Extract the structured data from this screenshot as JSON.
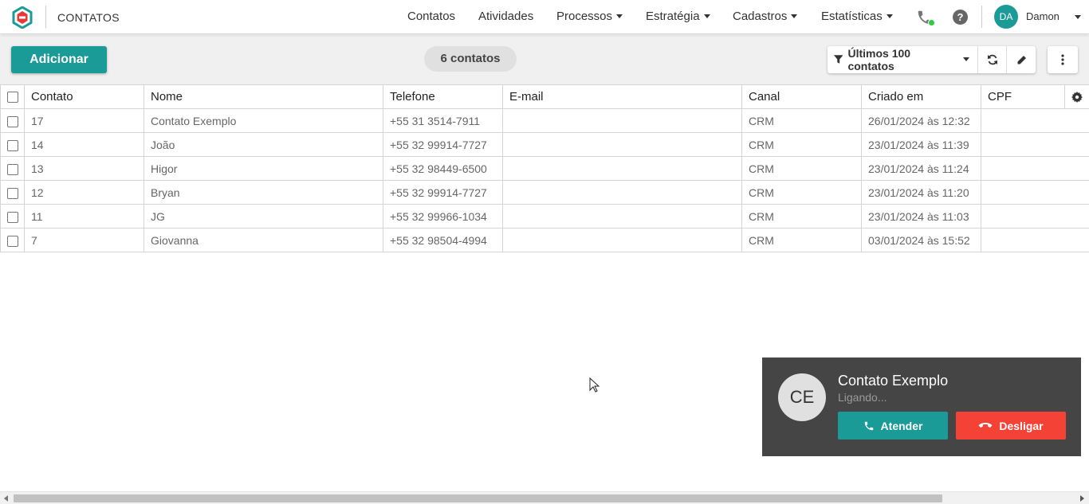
{
  "header": {
    "page_title": "CONTATOS",
    "menu": [
      {
        "label": "Contatos",
        "dropdown": false
      },
      {
        "label": "Atividades",
        "dropdown": false
      },
      {
        "label": "Processos",
        "dropdown": true
      },
      {
        "label": "Estratégia",
        "dropdown": true
      },
      {
        "label": "Cadastros",
        "dropdown": true
      },
      {
        "label": "Estatísticas",
        "dropdown": true
      }
    ],
    "phone_status_color": "#2ecc40",
    "help_label": "?",
    "user": {
      "initials": "DA",
      "name": "Damon"
    }
  },
  "toolbar": {
    "add_label": "Adicionar",
    "count_label": "6 contatos",
    "filter_label": "Últimos 100 contatos",
    "icons": [
      "filter-icon",
      "refresh-icon",
      "pencil-icon",
      "more-vertical-icon"
    ]
  },
  "table": {
    "columns": [
      "Contato",
      "Nome",
      "Telefone",
      "E-mail",
      "Canal",
      "Criado em",
      "CPF"
    ],
    "rows": [
      {
        "contato": "17",
        "nome": "Contato Exemplo",
        "telefone": "+55 31 3514-7911",
        "email": "",
        "canal": "CRM",
        "criado": "26/01/2024 às 12:32",
        "cpf": ""
      },
      {
        "contato": "14",
        "nome": "João",
        "telefone": "+55 32 99914-7727",
        "email": "",
        "canal": "CRM",
        "criado": "23/01/2024 às 11:39",
        "cpf": ""
      },
      {
        "contato": "13",
        "nome": "Higor",
        "telefone": "+55 32 98449-6500",
        "email": "",
        "canal": "CRM",
        "criado": "23/01/2024 às 11:24",
        "cpf": ""
      },
      {
        "contato": "12",
        "nome": "Bryan",
        "telefone": "+55 32 99914-7727",
        "email": "",
        "canal": "CRM",
        "criado": "23/01/2024 às 11:20",
        "cpf": ""
      },
      {
        "contato": "11",
        "nome": "JG",
        "telefone": "+55 32 99966-1034",
        "email": "",
        "canal": "CRM",
        "criado": "23/01/2024 às 11:03",
        "cpf": ""
      },
      {
        "contato": "7",
        "nome": "Giovanna",
        "telefone": "+55 32 98504-4994",
        "email": "",
        "canal": "CRM",
        "criado": "03/01/2024 às 15:52",
        "cpf": ""
      }
    ]
  },
  "call": {
    "initials": "CE",
    "name": "Contato Exemplo",
    "status": "Ligando...",
    "answer_label": "Atender",
    "hangup_label": "Desligar"
  },
  "colors": {
    "accent": "#1a9b97",
    "danger": "#f44336",
    "popup_bg": "#454545"
  }
}
